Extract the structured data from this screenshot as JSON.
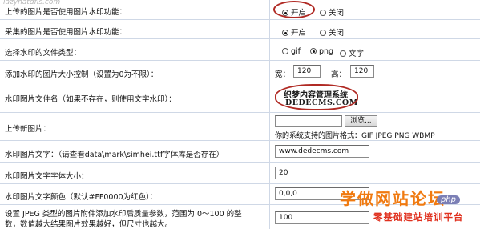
{
  "top_watermark": "lazyhatdfls.com",
  "rows": [
    {
      "label": "上传的图片是否使用图片水印功能：",
      "options": [
        "开启",
        "关闭"
      ],
      "selected": 0
    },
    {
      "label": "采集的图片是否使用图片水印功能：",
      "options": [
        "开启",
        "关闭"
      ],
      "selected": 0
    },
    {
      "label": "选择水印的文件类型：",
      "options": [
        "gif",
        "png",
        "文字"
      ],
      "selected": 1
    },
    {
      "label": "添加水印的图片大小控制（设置为0为不限）：",
      "width_label": "宽：",
      "width_value": "120",
      "height_label": "高：",
      "height_value": "120"
    },
    {
      "label": "水印图片文件名（如果不存在，则使用文字水印）：",
      "sample_line1": "织梦内容管理系统",
      "sample_line2": "DEDECMS.COM"
    },
    {
      "label": "上传新图片：",
      "browse_label": "浏览...",
      "file_value": "",
      "hint": "你的系统支持的图片格式：GIF JPEG PNG WBMP"
    },
    {
      "label": "水印图片文字：（请查看data\\mark\\simhei.ttf字体库是否存在）",
      "value": "www.dedecms.com"
    },
    {
      "label": "水印图片文字字体大小：",
      "value": "20"
    },
    {
      "label": "水印图片文字颜色（默认#FF0000为红色）：",
      "value": "0,0,0"
    },
    {
      "label_line1": "设置 JPEG 类型的图片附件添加水印后质量参数，范围为 0～100 的整",
      "label_line2": "数，数值越大结果图片效果越好，但尺寸也越大。",
      "value": "100"
    }
  ],
  "overlay_brand": {
    "title": "学做网站论坛",
    "subtitle": "零基础建站培训平台",
    "php_badge": "php",
    "title_color": "#f07a10",
    "subtitle_color": "#e0301e"
  },
  "colors": {
    "annotation_red": "#b02a24",
    "row_border": "#cfd8e6"
  }
}
